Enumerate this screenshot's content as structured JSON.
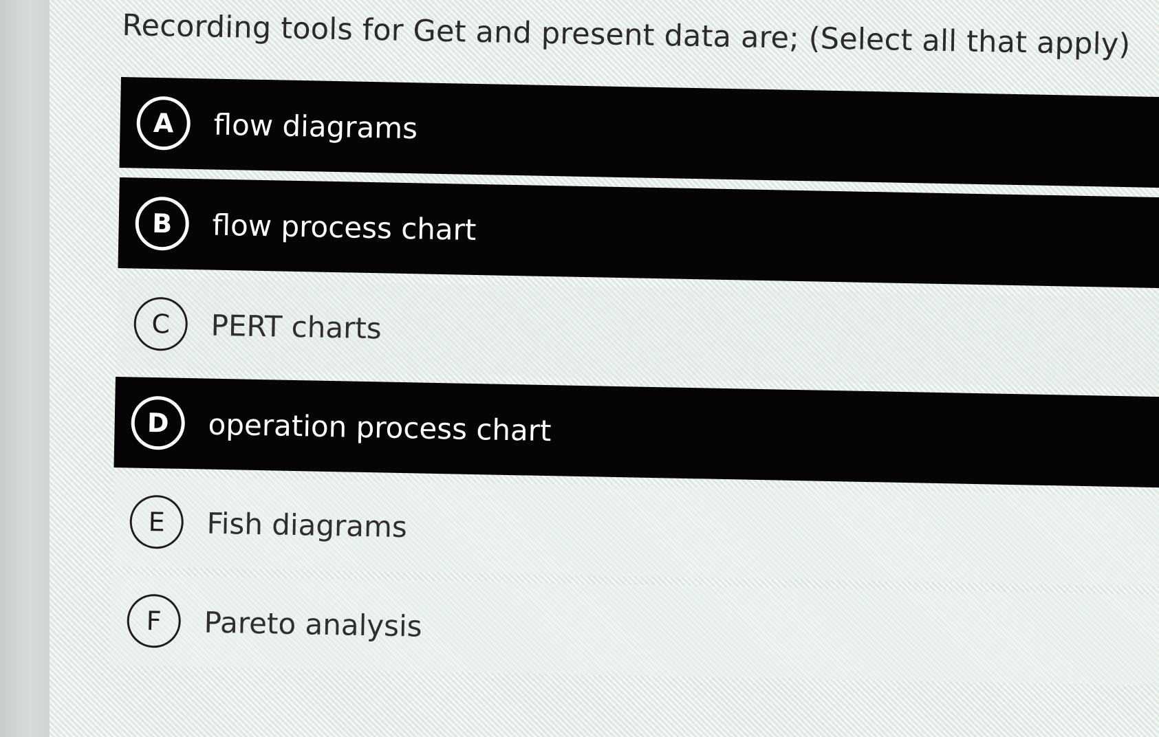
{
  "question": {
    "text": "Recording tools for Get and present data are; (Select all that apply)"
  },
  "options": [
    {
      "letter": "A",
      "label": "flow diagrams",
      "selected": true
    },
    {
      "letter": "B",
      "label": "flow process chart",
      "selected": true
    },
    {
      "letter": "C",
      "label": "PERT charts",
      "selected": false
    },
    {
      "letter": "D",
      "label": "operation process chart",
      "selected": true
    },
    {
      "letter": "E",
      "label": "Fish diagrams",
      "selected": false
    },
    {
      "letter": "F",
      "label": "Pareto analysis",
      "selected": false
    }
  ],
  "colors": {
    "selected_bg": "#050505",
    "selected_text": "#ffffff",
    "unselected_text": "#2f2f2f",
    "page_bg": "#e6efe9"
  }
}
